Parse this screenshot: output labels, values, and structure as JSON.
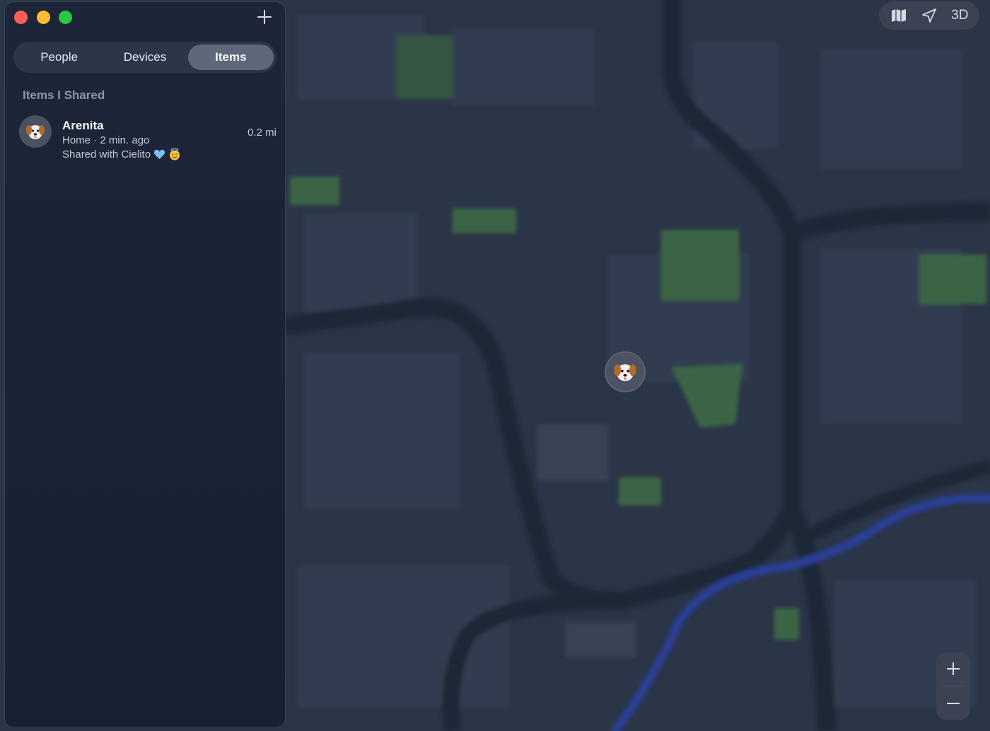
{
  "sidebar": {
    "tabs": [
      {
        "label": "People"
      },
      {
        "label": "Devices"
      },
      {
        "label": "Items"
      }
    ],
    "active_tab": "Items",
    "section_title": "Items I Shared",
    "items": [
      {
        "name": "Arenita",
        "location_time": "Home · 2 min. ago",
        "shared_with": "Shared with Cielito",
        "distance": "0.2 mi",
        "icon": "dog-emoji-icon"
      }
    ]
  },
  "map_tools": {
    "three_d_label": "3D",
    "icons": [
      "map-icon",
      "location-arrow-icon"
    ]
  },
  "colors": {
    "map_bg": "#2b3548",
    "park": "#3c6b45",
    "river": "#2a3f9e",
    "road": "#1f2534",
    "close": "#ff5f57",
    "minimize": "#febc2e",
    "maximize": "#28c840"
  }
}
